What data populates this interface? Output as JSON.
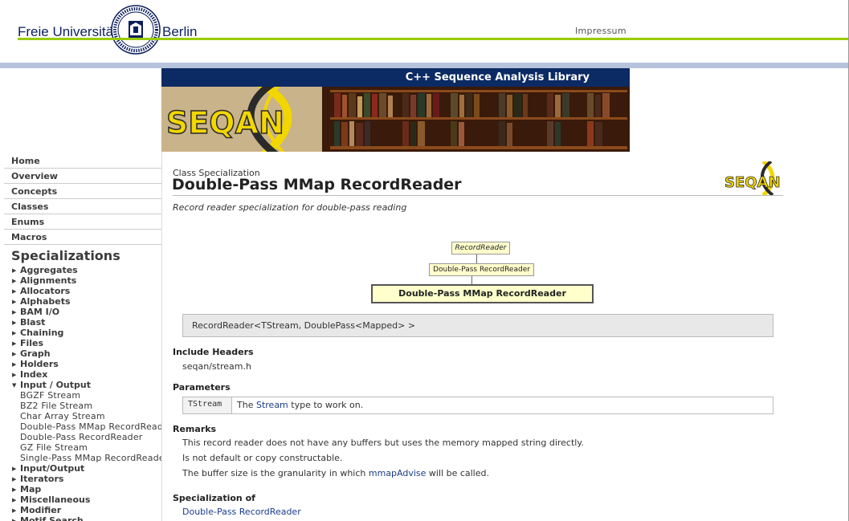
{
  "header": {
    "university_left": "Freie Universität",
    "university_right": "Berlin",
    "impressum": "Impressum"
  },
  "banner": {
    "title": "C++ Sequence Analysis Library",
    "logo_text": "SEQAN"
  },
  "nav": {
    "top_links": [
      "Home",
      "Overview",
      "Concepts",
      "Classes",
      "Enums",
      "Macros"
    ],
    "heading": "Specializations",
    "groups_before": [
      "Aggregates",
      "Alignments",
      "Allocators",
      "Alphabets",
      "BAM I/O",
      "Blast",
      "Chaining",
      "Files",
      "Graph",
      "Holders",
      "Index"
    ],
    "expanded_group": "Input / Output",
    "expanded_items": [
      "BGZF Stream",
      "BZ2 File Stream",
      "Char Array Stream",
      "Double-Pass MMap RecordReader",
      "Double-Pass RecordReader",
      "GZ File Stream",
      "Single-Pass MMap RecordReader"
    ],
    "groups_after": [
      "Input/Output",
      "Iterators",
      "Map",
      "Miscellaneous",
      "Modifier",
      "Motif Search"
    ]
  },
  "page": {
    "kind": "Class Specialization",
    "title": "Double-Pass MMap RecordReader",
    "summary": "Record reader specialization for double-pass reading",
    "logo_text": "SEQAN"
  },
  "diagram": {
    "root": "RecordReader",
    "parent": "Double-Pass RecordReader",
    "current": "Double-Pass MMap RecordReader"
  },
  "signature": "RecordReader<TStream, DoublePass<Mapped> >",
  "include_headers": {
    "heading": "Include Headers",
    "value": "seqan/stream.h"
  },
  "parameters": {
    "heading": "Parameters",
    "name": "TStream",
    "desc_before": "The ",
    "desc_link": "Stream",
    "desc_after": " type to work on."
  },
  "remarks": {
    "heading": "Remarks",
    "line1": "This record reader does not have any buffers but uses the memory mapped string directly.",
    "line2": "Is not default or copy constructable.",
    "line3_before": "The buffer size is the granularity in which ",
    "line3_link": "mmapAdvise",
    "line3_after": " will be called."
  },
  "specialization_of": {
    "heading": "Specialization of",
    "link": "Double-Pass RecordReader"
  },
  "colors": {
    "navy": "#0c2a63",
    "fu_green": "#99cc00",
    "link": "#1a3c8c",
    "node_fill": "#ffffcc",
    "seqan_yellow": "#f2d600"
  }
}
